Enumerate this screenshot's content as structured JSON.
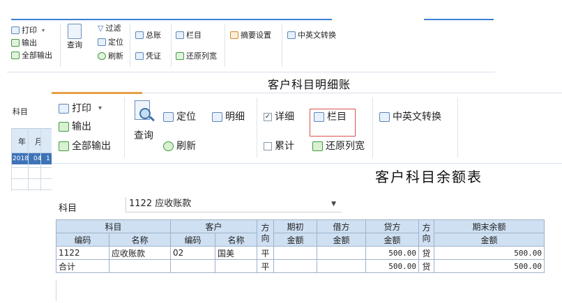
{
  "back_window": {
    "toolbar": {
      "print": "打印",
      "export": "输出",
      "export_all": "全部输出",
      "query": "查询",
      "filter": "过滤",
      "locate": "定位",
      "refresh": "刷新",
      "ledger": "总账",
      "voucher": "凭证",
      "columns": "栏目",
      "restore_width": "还原列宽",
      "summary_settings": "摘要设置",
      "lang_switch": "中英文转换"
    },
    "title": "客户科目明细账",
    "subject_label": "科目",
    "grid": {
      "col_year": "年",
      "col_month": "月",
      "row_year": "2018",
      "row_month": "04",
      "row_day": "1"
    }
  },
  "front_window": {
    "toolbar": {
      "print": "打印",
      "export": "输出",
      "export_all": "全部输出",
      "query": "查询",
      "locate": "定位",
      "refresh": "刷新",
      "detail_view": "明细",
      "detail_check": "详细",
      "cumulative_check": "累计",
      "columns": "栏目",
      "restore_width": "还原列宽",
      "lang_switch": "中英文转换"
    },
    "detail_checked": true,
    "cumulative_checked": false,
    "title": "客户科目余额表",
    "subject_label": "科目",
    "subject_value": "1122 应收账款",
    "table": {
      "group_headers": {
        "subject": "科目",
        "customer": "客户",
        "direction": "方向",
        "opening": "期初",
        "debit": "借方",
        "credit": "贷方",
        "closing": "期末余额"
      },
      "sub_headers": {
        "code": "编码",
        "name": "名称",
        "cust_code": "编码",
        "cust_name": "名称",
        "amount": "金额",
        "debit_amount": "金额",
        "credit_amount": "金额",
        "closing_amount": "金额"
      },
      "rows": [
        {
          "code": "1122",
          "name": "应收账款",
          "cust_code": "02",
          "cust_name": "国美",
          "dir": "平",
          "opening": "",
          "debit": "",
          "credit": "500.00",
          "dir2": "贷",
          "closing": "500.00"
        },
        {
          "code": "合计",
          "name": "",
          "cust_code": "",
          "cust_name": "",
          "dir": "平",
          "opening": "",
          "debit": "",
          "credit": "500.00",
          "dir2": "贷",
          "closing": "500.00"
        }
      ]
    }
  },
  "colors": {
    "accent_blue": "#3b7fd4",
    "accent_orange": "#e4a046",
    "header_bg": "#cfe0f3",
    "selected_row": "#3e73b8",
    "highlight_box": "#d9534f"
  }
}
